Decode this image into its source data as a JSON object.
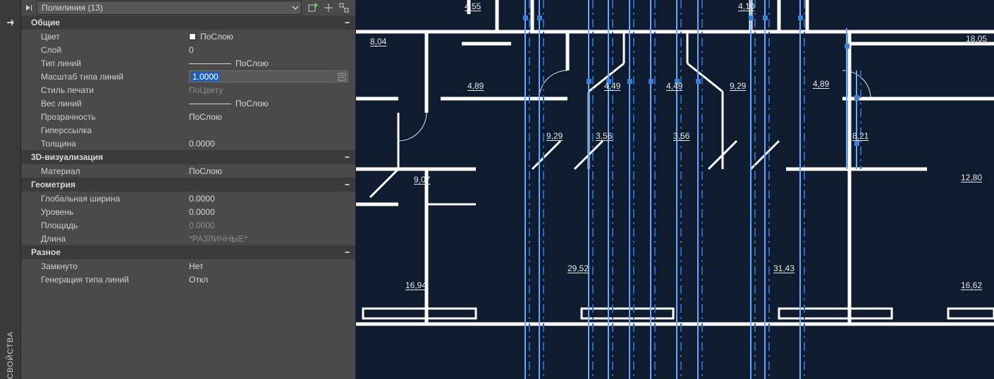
{
  "sidebar": {
    "title": "СВОЙСТВА"
  },
  "selector": {
    "value": "Полилиния (13)"
  },
  "categories": {
    "general": "Общие",
    "viz3d": "3D-визуализация",
    "geom": "Геометрия",
    "misc": "Разное"
  },
  "props": {
    "color": {
      "label": "Цвет",
      "value": "ПоСлою"
    },
    "layer": {
      "label": "Слой",
      "value": "0"
    },
    "ltype": {
      "label": "Тип линий",
      "value": "ПоСлою"
    },
    "ltscale": {
      "label": "Масштаб типа линий",
      "value": "1.0000"
    },
    "pstyle": {
      "label": "Стиль печати",
      "value": "ПоЦвету"
    },
    "lweight": {
      "label": "Вес линий",
      "value": "ПоСлою"
    },
    "transp": {
      "label": "Прозрачность",
      "value": "ПоСлою"
    },
    "hyper": {
      "label": "Гиперссылка",
      "value": ""
    },
    "thick": {
      "label": "Толщина",
      "value": "0.0000"
    },
    "material": {
      "label": "Материал",
      "value": "ПоСлою"
    },
    "gwidth": {
      "label": "Глобальная ширина",
      "value": "0.0000"
    },
    "elev": {
      "label": "Уровень",
      "value": "0.0000"
    },
    "area": {
      "label": "Площадь",
      "value": "0.0000"
    },
    "length": {
      "label": "Длина",
      "value": "*РАЗЛИЧНЫЕ*"
    },
    "closed": {
      "label": "Замкнуто",
      "value": "Нет"
    },
    "ltgen": {
      "label": "Генерация типа линий",
      "value": "Откл"
    }
  },
  "dims": {
    "d455": "4,55",
    "d410": "4,10",
    "d804": "8,04",
    "d1805": "18,05",
    "d489a": "4,89",
    "d449a": "4,49",
    "d449b": "4,49",
    "d929a": "9,29",
    "d489b": "4,89",
    "d929b": "9,29",
    "d356a": "3,56",
    "d356b": "3,56",
    "d821": "8,21",
    "d907": "9,07",
    "d1280": "12,80",
    "d1694": "16,94",
    "d2952": "29,52",
    "d3143": "31,43",
    "d1662": "16,62"
  }
}
